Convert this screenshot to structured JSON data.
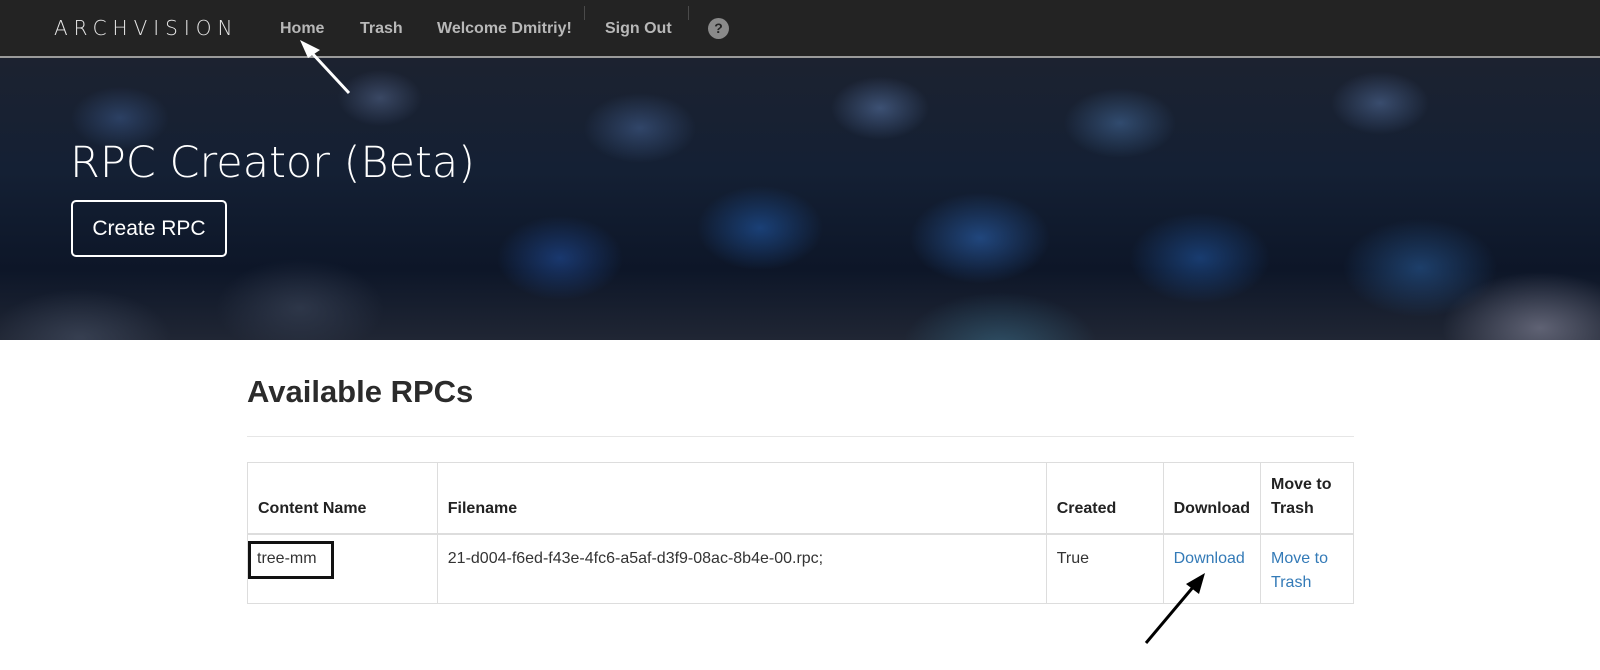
{
  "navbar": {
    "brand": "ARCHVISION",
    "links": [
      {
        "label": "Home"
      },
      {
        "label": "Trash"
      },
      {
        "label": "Welcome Dmitriy!"
      },
      {
        "label": "Sign Out"
      }
    ],
    "help_icon": "question-circle-icon",
    "help_glyph": "?"
  },
  "hero": {
    "title": "RPC Creator (Beta)",
    "button_label": "Create RPC"
  },
  "main": {
    "title": "Available RPCs",
    "table": {
      "headers": [
        "Content Name",
        "Filename",
        "Created",
        "Download",
        "Move to Trash"
      ],
      "rows": [
        {
          "content_name": "tree-mm",
          "filename": "21-d004-f6ed-f43e-4fc6-a5af-d3f9-08ac-8b4e-00.rpc;",
          "created": "True",
          "download": "Download",
          "move_to_trash": "Move to Trash"
        }
      ]
    }
  },
  "colors": {
    "navbar_bg": "#232323",
    "link": "#337ab7",
    "annotation": "#000000"
  }
}
